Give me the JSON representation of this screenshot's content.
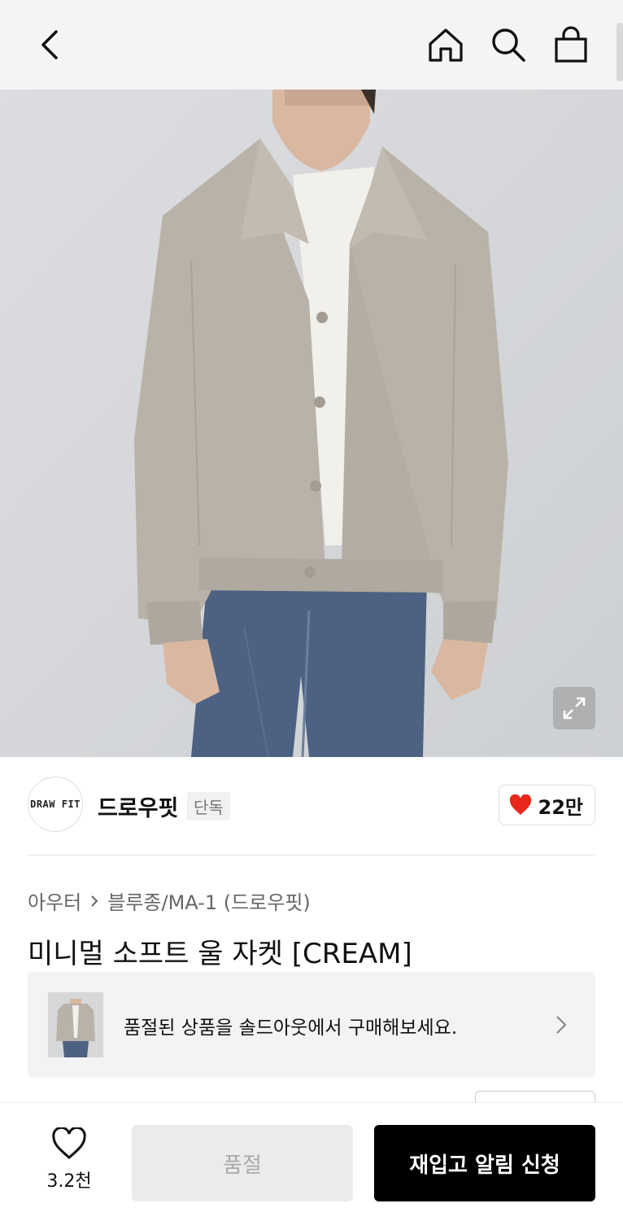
{
  "header": {
    "back_icon": "chevron-left-icon",
    "home_icon": "home-icon",
    "search_icon": "search-icon",
    "cart_icon": "shopping-bag-icon"
  },
  "hero": {
    "expand_icon": "expand-icon"
  },
  "brand": {
    "logo_text": "DRAW FIT",
    "name": "드로우핏",
    "tag": "단독",
    "likes": "22만",
    "heart_color": "#e8281c"
  },
  "breadcrumb": {
    "category": "아우터",
    "subcategory": "블루종/MA-1 (드로우핏)"
  },
  "product": {
    "title": "미니멀 소프트 울 자켓 [CREAM]"
  },
  "soldout_banner": {
    "message": "품절된 상품을 솔드아웃에서 구매해보세요."
  },
  "bottom": {
    "wish_count": "3.2천",
    "soldout_label": "품절",
    "restock_label": "재입고 알림 신청"
  },
  "colors": {
    "accent_red": "#e8281c",
    "cta_black": "#000000",
    "jacket": "#b9b2a8",
    "denim": "#4d6282"
  }
}
